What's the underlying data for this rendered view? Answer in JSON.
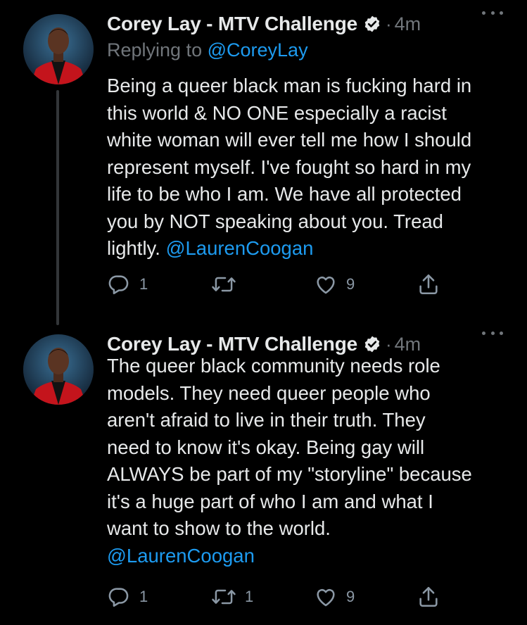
{
  "tweets": [
    {
      "author_name": "Corey Lay - MTV Challenge",
      "separator": "·",
      "time": "4m",
      "replying_prefix": "Replying to",
      "replying_handle": "@CoreyLay",
      "text_lines": [
        "Being a queer black man is fucking hard in",
        "this world & NO ONE especially a racist",
        "white woman will ever tell me how I should",
        "represent myself. I've fought so hard in my",
        "life to be who I am. We have all protected",
        "you by NOT speaking about you. Tread",
        "lightly."
      ],
      "mention": "@LaurenCoogan",
      "reply_count": "1",
      "retweet_count": "",
      "like_count": "9"
    },
    {
      "author_name": "Corey Lay - MTV Challenge",
      "separator": "·",
      "time": "4m",
      "text_lines": [
        "The queer black community needs role",
        "models. They need queer people who",
        "aren't afraid to live in their truth. They",
        "need to know it's okay. Being gay will",
        "ALWAYS be part of my \"storyline\" because",
        "it's a huge part of who I am and what I",
        "want to show to the world."
      ],
      "mention": "@LaurenCoogan",
      "reply_count": "1",
      "retweet_count": "1",
      "like_count": "9"
    }
  ],
  "icons": {
    "verified": "verified-badge-icon",
    "more": "more-options-icon",
    "reply": "reply-bubble-icon",
    "retweet": "retweet-icon",
    "like": "heart-icon",
    "share": "share-upload-icon"
  },
  "colors": {
    "background": "#000000",
    "text": "#e7e9ea",
    "muted": "#71767b",
    "link": "#1d9bf0",
    "action_icons": "#8b98a5"
  }
}
